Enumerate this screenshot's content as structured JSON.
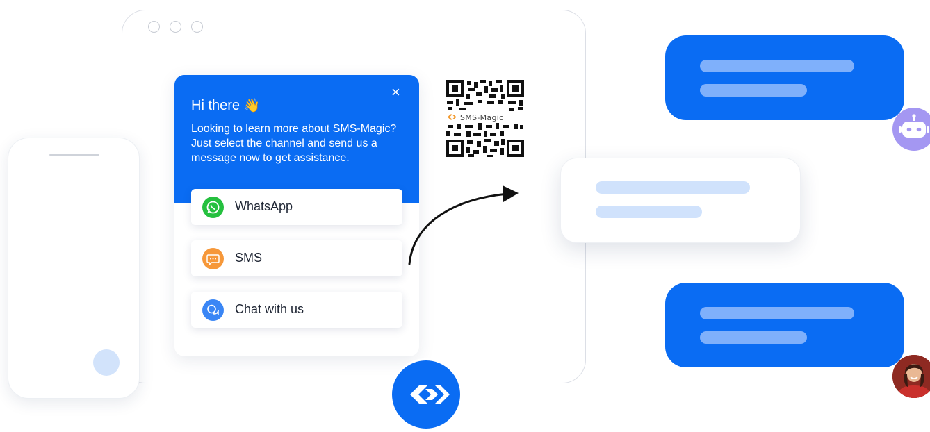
{
  "widget": {
    "greeting": "Hi there",
    "wave_emoji": "👋",
    "intro": "Looking to learn more about SMS-Magic? Just select the channel and send us a message now to get assistance.",
    "close_icon": "×",
    "channels": [
      {
        "label": "WhatsApp",
        "icon": "whatsapp-icon",
        "color": "#25c03f"
      },
      {
        "label": "SMS",
        "icon": "sms-icon",
        "color": "#f6983a"
      },
      {
        "label": "Chat with us",
        "icon": "chat-icon",
        "color": "#3a86f5"
      }
    ]
  },
  "qr": {
    "brand_text": "SMS-Magic"
  },
  "colors": {
    "brand_blue": "#0a6cf3",
    "light_bar": "#7fb0fb",
    "pale_bar": "#d0e2fc",
    "bot_purple": "#a497f2"
  }
}
